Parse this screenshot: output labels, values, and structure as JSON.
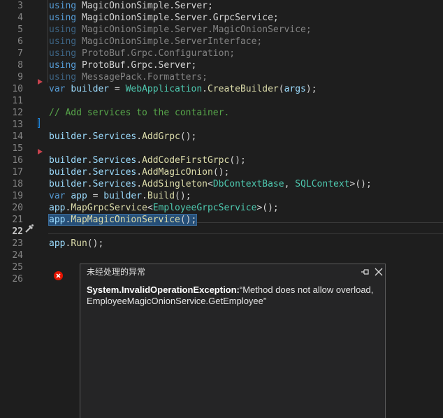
{
  "editor": {
    "lines": [
      {
        "n": "3",
        "parts": [
          [
            "kw",
            "using"
          ],
          [
            "ns",
            " MagicOnionSimple.Server;"
          ]
        ]
      },
      {
        "n": "4",
        "parts": [
          [
            "kw",
            "using"
          ],
          [
            "ns",
            " MagicOnionSimple.Server.GrpcService;"
          ]
        ]
      },
      {
        "n": "5",
        "dim": true,
        "parts": [
          [
            "kw",
            "using"
          ],
          [
            "ns",
            " MagicOnionSimple.Server.MagicOnionService;"
          ]
        ]
      },
      {
        "n": "6",
        "dim": true,
        "parts": [
          [
            "kw",
            "using"
          ],
          [
            "ns",
            " MagicOnionSimple.ServerInterface;"
          ]
        ]
      },
      {
        "n": "7",
        "dim": true,
        "parts": [
          [
            "kw",
            "using"
          ],
          [
            "ns",
            " ProtoBuf.Grpc.Configuration;"
          ]
        ]
      },
      {
        "n": "8",
        "parts": [
          [
            "kw",
            "using"
          ],
          [
            "ns",
            " ProtoBuf.Grpc.Server;"
          ]
        ]
      },
      {
        "n": "9",
        "dim": true,
        "parts": [
          [
            "kw",
            "using"
          ],
          [
            "ns",
            " MessagePack.Formatters;"
          ]
        ]
      },
      {
        "n": "10",
        "parts": [
          [
            "kw",
            "var"
          ],
          [
            "ns",
            " "
          ],
          [
            "prop",
            "builder"
          ],
          [
            "ns",
            " = "
          ],
          [
            "ty",
            "WebApplication"
          ],
          [
            "ns",
            "."
          ],
          [
            "mth",
            "CreateBuilder"
          ],
          [
            "ns",
            "("
          ],
          [
            "prop",
            "args"
          ],
          [
            "ns",
            ");"
          ]
        ]
      },
      {
        "n": "11",
        "parts": []
      },
      {
        "n": "12",
        "parts": [
          [
            "cmt",
            "// Add services to the container."
          ]
        ]
      },
      {
        "n": "13",
        "parts": []
      },
      {
        "n": "14",
        "parts": [
          [
            "prop",
            "builder"
          ],
          [
            "ns",
            "."
          ],
          [
            "prop",
            "Services"
          ],
          [
            "ns",
            "."
          ],
          [
            "mth",
            "AddGrpc"
          ],
          [
            "ns",
            "();"
          ]
        ]
      },
      {
        "n": "15",
        "parts": []
      },
      {
        "n": "16",
        "parts": [
          [
            "prop",
            "builder"
          ],
          [
            "ns",
            "."
          ],
          [
            "prop",
            "Services"
          ],
          [
            "ns",
            "."
          ],
          [
            "mth",
            "AddCodeFirstGrpc"
          ],
          [
            "ns",
            "();"
          ]
        ]
      },
      {
        "n": "17",
        "parts": [
          [
            "prop",
            "builder"
          ],
          [
            "ns",
            "."
          ],
          [
            "prop",
            "Services"
          ],
          [
            "ns",
            "."
          ],
          [
            "mth",
            "AddMagicOnion"
          ],
          [
            "ns",
            "();"
          ]
        ]
      },
      {
        "n": "18",
        "parts": [
          [
            "prop",
            "builder"
          ],
          [
            "ns",
            "."
          ],
          [
            "prop",
            "Services"
          ],
          [
            "ns",
            "."
          ],
          [
            "mth",
            "AddSingleton"
          ],
          [
            "ns",
            "<"
          ],
          [
            "ty",
            "DbContextBase"
          ],
          [
            "ns",
            ", "
          ],
          [
            "ty",
            "SQLContext"
          ],
          [
            "ns",
            ">();"
          ]
        ]
      },
      {
        "n": "19",
        "parts": [
          [
            "kw",
            "var"
          ],
          [
            "ns",
            " "
          ],
          [
            "prop",
            "app"
          ],
          [
            "ns",
            " = "
          ],
          [
            "prop",
            "builder"
          ],
          [
            "ns",
            "."
          ],
          [
            "mth",
            "Build"
          ],
          [
            "ns",
            "();"
          ]
        ]
      },
      {
        "n": "20",
        "parts": [
          [
            "prop",
            "app"
          ],
          [
            "ns",
            "."
          ],
          [
            "mth",
            "MapGrpcService"
          ],
          [
            "ns",
            "<"
          ],
          [
            "ty",
            "EmployeeGrpcService"
          ],
          [
            "ns",
            ">();"
          ]
        ]
      },
      {
        "n": "21",
        "selected": true,
        "parts": [
          [
            "prop",
            "app"
          ],
          [
            "ns",
            "."
          ],
          [
            "mth",
            "MapMagicOnionService"
          ],
          [
            "ns",
            "();"
          ]
        ]
      },
      {
        "n": "22",
        "current": true,
        "parts": []
      },
      {
        "n": "23",
        "parts": [
          [
            "prop",
            "app"
          ],
          [
            "ns",
            "."
          ],
          [
            "mth",
            "Run"
          ],
          [
            "ns",
            "();"
          ]
        ]
      },
      {
        "n": "24",
        "parts": []
      },
      {
        "n": "25",
        "parts": []
      },
      {
        "n": "26",
        "parts": []
      }
    ]
  },
  "exception_popup": {
    "title": "未经处理的异常",
    "exception_type": "System.InvalidOperationException:",
    "message": "“Method does not allow overload, EmployeeMagicOnionService.GetEmployee”",
    "icons": {
      "pin": "pin-icon",
      "close": "close-icon",
      "error": "error-icon"
    }
  },
  "colors": {
    "background": "#1e1e1e",
    "keyword": "#569cd6",
    "type": "#4ec9b0",
    "method": "#dcdcaa",
    "variable": "#9cdcfe",
    "comment": "#57a64a",
    "error": "#e51400"
  }
}
